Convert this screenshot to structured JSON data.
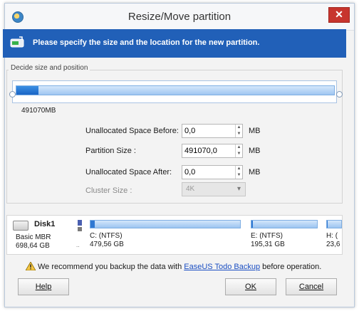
{
  "window": {
    "title": "Resize/Move partition",
    "close_glyph": "✕"
  },
  "banner": {
    "text": "Please specify the size and the location for the new partition.",
    "icon": "partition-resize-icon"
  },
  "group": {
    "title": "Decide size and position"
  },
  "slider": {
    "size_label": "491070MB",
    "partition_fraction": 0.07
  },
  "fields": {
    "unalloc_before": {
      "label": "Unallocated Space Before:",
      "value": "0,0",
      "unit": "MB"
    },
    "partition_size": {
      "label": "Partition Size :",
      "value": "491070,0",
      "unit": "MB"
    },
    "unalloc_after": {
      "label": "Unallocated Space After:",
      "value": "0,0",
      "unit": "MB"
    },
    "cluster_size": {
      "label": "Cluster Size :",
      "value": "4K"
    }
  },
  "disk": {
    "name": "Disk1",
    "type": "Basic MBR",
    "size": "698,64 GB",
    "partitions": [
      {
        "name": "C: (NTFS)",
        "size": "479,56 GB",
        "used_fraction": 0.03
      },
      {
        "name": "E: (NTFS)",
        "size": "195,31 GB",
        "used_fraction": 0.02
      },
      {
        "name": "H: (",
        "size": "23,6",
        "used_fraction": 0.05
      }
    ]
  },
  "notice": {
    "before": "We recommend you backup the data with ",
    "link": "EaseUS Todo Backup",
    "after": " before operation."
  },
  "buttons": {
    "help": "Help",
    "ok": "OK",
    "cancel": "Cancel"
  },
  "colors": {
    "banner": "#2160b8",
    "close": "#c7352e",
    "accent": "#1964c4"
  }
}
